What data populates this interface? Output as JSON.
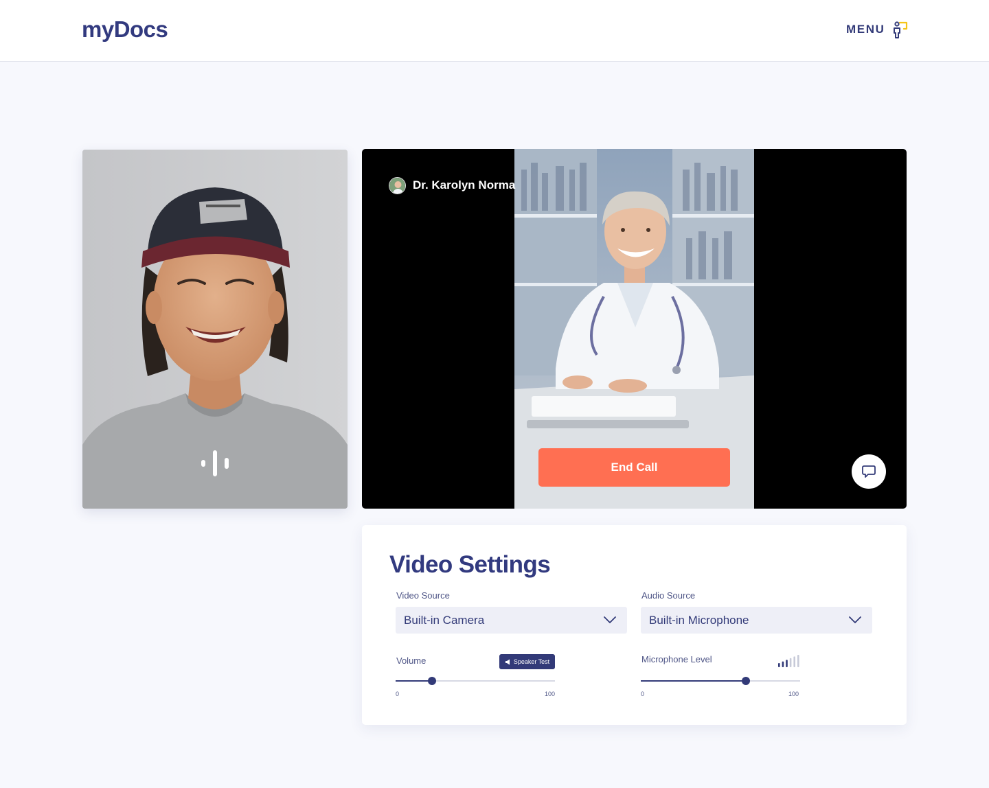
{
  "header": {
    "logo": "myDocs",
    "menu_label": "MENU",
    "menu_icon": "person-frame-icon"
  },
  "patient_video": {
    "mic_icon": "audio-activity-icon"
  },
  "doctor_video": {
    "name": "Dr. Karolyn Norma",
    "end_call_label": "End Call",
    "chat_icon": "chat-bubble-icon"
  },
  "settings": {
    "title": "Video Settings",
    "video_source": {
      "label": "Video Source",
      "value": "Built-in Camera"
    },
    "audio_source": {
      "label": "Audio Source",
      "value": "Built-in Microphone"
    },
    "volume": {
      "label": "Volume",
      "min": "0",
      "max": "100",
      "value": 23,
      "speaker_test_label": "Speaker Test"
    },
    "mic_level": {
      "label": "Microphone Level",
      "min": "0",
      "max": "100",
      "value": 66,
      "level_bars_active": 3,
      "level_bars_total": 6
    }
  },
  "colors": {
    "brand": "#323a78",
    "end_call": "#ff6f52",
    "background": "#f7f8fd",
    "menu_accent": "#f5c518"
  }
}
